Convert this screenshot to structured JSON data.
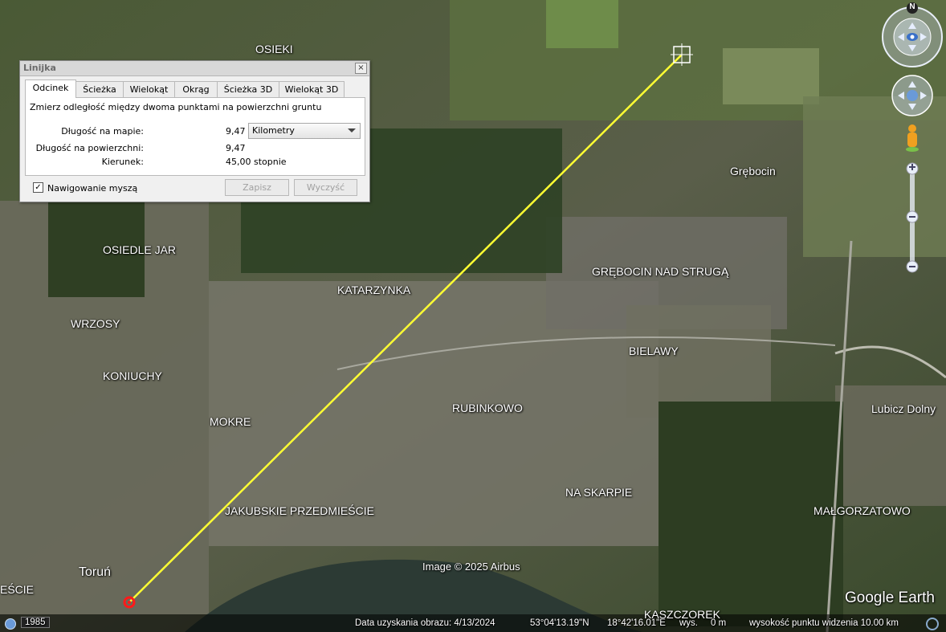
{
  "map_labels": [
    {
      "text": "OSIEKI",
      "cls": "osieki"
    },
    {
      "text": "Grębocin",
      "cls": "grebocin"
    },
    {
      "text": "OSIEDLE JAR",
      "cls": "jar"
    },
    {
      "text": "GRĘBOCIN NAD STRUGĄ",
      "cls": "gns"
    },
    {
      "text": "KATARZYNKA",
      "cls": "kat"
    },
    {
      "text": "WRZOSY",
      "cls": "wrzosy"
    },
    {
      "text": "BIELAWY",
      "cls": "bielawy"
    },
    {
      "text": "KONIUCHY",
      "cls": "koniuchy"
    },
    {
      "text": "RUBINKOWO",
      "cls": "rubinkowo"
    },
    {
      "text": "Lubicz Dolny",
      "cls": "lubicz"
    },
    {
      "text": "MOKRE",
      "cls": "mokre"
    },
    {
      "text": "NA SKARPIE",
      "cls": "skarpie"
    },
    {
      "text": "MAŁGORZATOWO",
      "cls": "malg"
    },
    {
      "text": "JAKUBSKIE PRZEDMIEŚCIE",
      "cls": "jakub"
    },
    {
      "text": "Toruń",
      "cls": "torun"
    },
    {
      "text": "EŚCIE",
      "cls": "escie"
    },
    {
      "text": "KASZCZOREK",
      "cls": "kasz"
    }
  ],
  "attribution": "Image © 2025 Airbus",
  "logo": "Google Earth",
  "dialog": {
    "title": "Linijka",
    "close": "×",
    "tabs": [
      "Odcinek",
      "Ścieżka",
      "Wielokąt",
      "Okrąg",
      "Ścieżka 3D",
      "Wielokąt 3D"
    ],
    "description": "Zmierz odległość między dwoma punktami na powierzchni gruntu",
    "map_length_label": "Długość na mapie:",
    "map_length_value": "9,47",
    "unit": "Kilometry",
    "ground_length_label": "Długość na powierzchni:",
    "ground_length_value": "9,47",
    "heading_label": "Kierunek:",
    "heading_value": "45,00 stopnie",
    "mouse_nav_label": "Nawigowanie myszą",
    "mouse_nav_checked": "✓",
    "save_label": "Zapisz",
    "clear_label": "Wyczyść"
  },
  "compass": {
    "north": "N"
  },
  "status": {
    "year": "1985",
    "image_date": "Data uzyskania obrazu: 4/13/2024",
    "lat": "53°04'13.19\"N",
    "lon": "18°42'16.01\"E",
    "elev": "wys.     0 m",
    "eye_alt": "wysokość punktu widzenia  10.00 km"
  }
}
